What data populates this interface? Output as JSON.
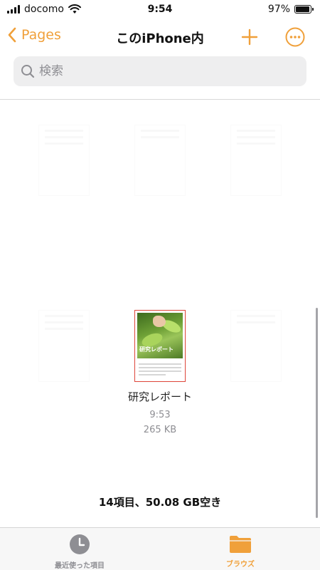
{
  "status": {
    "carrier": "docomo",
    "time": "9:54",
    "battery_text": "97%",
    "battery_level": 0.97
  },
  "nav": {
    "back_label": "Pages",
    "title": "このiPhone内",
    "accent": "#f0a03a"
  },
  "search": {
    "placeholder": "検索"
  },
  "files": [
    {
      "name": "",
      "time": "",
      "size": "",
      "faded": true
    },
    {
      "name": "",
      "time": "",
      "size": "",
      "faded": true
    },
    {
      "name": "",
      "time": "",
      "size": "",
      "faded": true
    },
    {
      "name": "",
      "time": "",
      "size": "",
      "faded": true
    },
    {
      "name": "研究レポート",
      "time": "9:53",
      "size": "265 KB",
      "faded": false,
      "thumb_label": "研究レポート"
    },
    {
      "name": "",
      "time": "",
      "size": "",
      "faded": true
    }
  ],
  "storage_info": "14項目、50.08 GB空き",
  "tabs": [
    {
      "label": "最近使った項目",
      "icon": "clock-icon",
      "active": false
    },
    {
      "label": "ブラウズ",
      "icon": "folder-icon",
      "active": true
    }
  ]
}
